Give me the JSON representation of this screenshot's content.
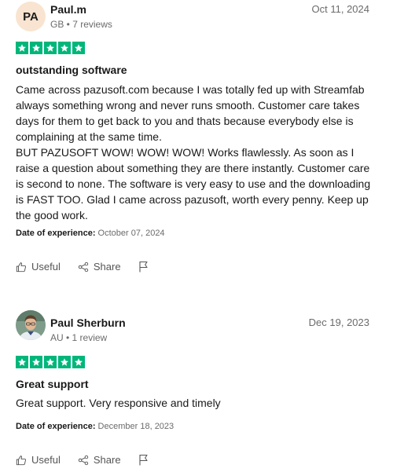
{
  "colors": {
    "star_green": "#00b67a",
    "text": "#191919",
    "muted": "#6b6b6b",
    "avatar_bg": "#f8e4d0"
  },
  "reviews": [
    {
      "avatar_initials": "PA",
      "author": "Paul.m",
      "meta": "GB • 7 reviews",
      "date": "Oct 11, 2024",
      "rating": 5,
      "title": "outstanding software",
      "body": "Came across pazusoft.com because I was totally fed up with Streamfab always something wrong and never runs smooth. Customer care takes days for them to get back to you and thats because everybody else is complaining at the same time.\nBUT PAZUSOFT WOW! WOW! WOW! Works flawlessly. As soon as I raise a question about something they are there instantly. Customer care is second to none. The software is very easy to use and the downloading is FAST TOO. Glad I came across pazusoft, worth every penny. Keep up the good work.",
      "experience_label": "Date of experience:",
      "experience_date": "October 07, 2024",
      "useful_label": "Useful",
      "share_label": "Share"
    },
    {
      "avatar_type": "photo",
      "author": "Paul Sherburn",
      "meta": "AU • 1 review",
      "date": "Dec 19, 2023",
      "rating": 5,
      "title": "Great support",
      "body": "Great support. Very responsive and timely",
      "experience_label": "Date of experience:",
      "experience_date": "December 18, 2023",
      "useful_label": "Useful",
      "share_label": "Share"
    }
  ]
}
